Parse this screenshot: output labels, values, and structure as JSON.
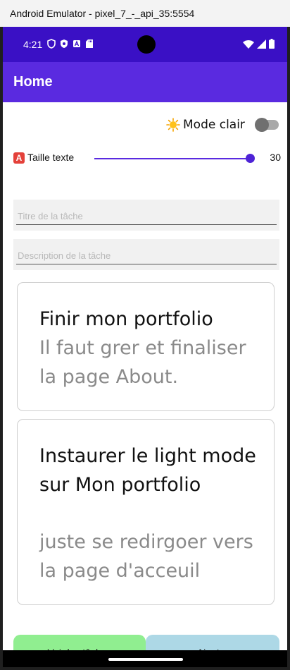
{
  "window": {
    "title": "Android Emulator - pixel_7_-_api_35:5554"
  },
  "statusbar": {
    "time": "4:21"
  },
  "appbar": {
    "title": "Home"
  },
  "theme_toggle": {
    "emoji": "🌞",
    "label": "Mode clair",
    "on": false
  },
  "text_size": {
    "emoji": "🅰️",
    "label": "Taille texte",
    "value": "30",
    "slider_fraction": 1.0
  },
  "form": {
    "title_placeholder": "Titre de la tâche",
    "description_placeholder": "Description de la tâche"
  },
  "tasks": [
    {
      "title": "Finir mon portfolio",
      "description": "Il faut grer et finaliser la page About."
    },
    {
      "title": "Instaurer le light mode sur Mon portfolio",
      "description": "juste se redirgoer vers la page d'acceuil"
    }
  ],
  "buttons": {
    "view_tasks": "Voir les tâches",
    "add": "Ajouter"
  },
  "colors": {
    "statusbar": "#3a10c5",
    "appbar": "#5a2ae0",
    "view_button": "#90ee90",
    "add_button": "#add8e6"
  }
}
